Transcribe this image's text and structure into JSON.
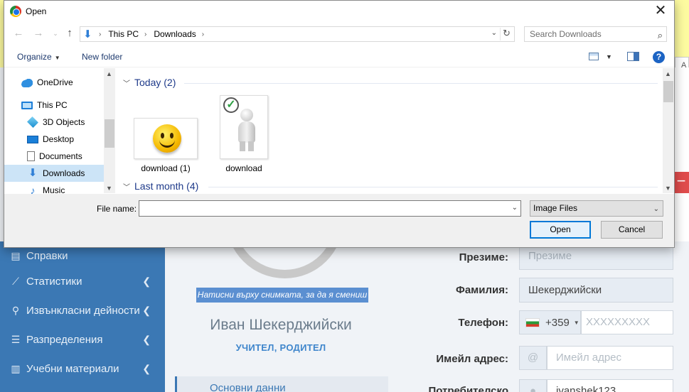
{
  "background": {
    "sidebar": {
      "items": [
        {
          "label": "Справки",
          "icon": "reference-icon",
          "has_arrow": false
        },
        {
          "label": "Статистики",
          "icon": "chart-icon",
          "has_arrow": true
        },
        {
          "label": "Извънкласни дейности",
          "icon": "running-icon",
          "has_arrow": true
        },
        {
          "label": "Разпределения",
          "icon": "list-icon",
          "has_arrow": true
        },
        {
          "label": "Учебни материали",
          "icon": "books-icon",
          "has_arrow": true
        }
      ]
    },
    "profile": {
      "photo_hint": "Натисни върху снимката, за да я смениш",
      "name": "Иван Шекерджийски",
      "role": "УЧИТЕЛ, РОДИТЕЛ",
      "tab_basic": "Основни данни"
    },
    "form": {
      "middle_name_label": "Презиме:",
      "middle_name_placeholder": "Презиме",
      "last_name_label": "Фамилия:",
      "last_name_value": "Шекерджийски",
      "phone_label": "Телефон:",
      "phone_prefix": "+359",
      "phone_placeholder": "XXXXXXXXX",
      "email_label": "Имейл адрес:",
      "email_placeholder": "Имейл адрес",
      "email_addon": "@",
      "username_label": "Потребителско",
      "username_value": "ivanshek123"
    },
    "topbar_partial": "A"
  },
  "dialog": {
    "title": "Open",
    "close_glyph": "✕",
    "address": {
      "segments": [
        "This PC",
        "Downloads"
      ],
      "search_placeholder": "Search Downloads"
    },
    "toolbar": {
      "organize_label": "Organize",
      "new_folder_label": "New folder",
      "help_label": "?"
    },
    "nav_items": [
      {
        "label": "OneDrive",
        "icon": "onedrive-icon"
      },
      {
        "label": "This PC",
        "icon": "this-pc-icon"
      },
      {
        "label": "3D Objects",
        "icon": "3d-objects-icon"
      },
      {
        "label": "Desktop",
        "icon": "desktop-icon"
      },
      {
        "label": "Documents",
        "icon": "documents-icon"
      },
      {
        "label": "Downloads",
        "icon": "downloads-icon",
        "selected": true
      },
      {
        "label": "Music",
        "icon": "music-icon"
      }
    ],
    "groups": [
      {
        "label": "Today (2)"
      },
      {
        "label": "Last month (4)"
      }
    ],
    "files": [
      {
        "name": "download (1)",
        "thumb": "smiley-image"
      },
      {
        "name": "download",
        "thumb": "checkmark-figure-image"
      }
    ],
    "file_name_label": "File name:",
    "file_name_value": "",
    "file_type": "Image Files",
    "open_label": "Open",
    "cancel_label": "Cancel"
  },
  "colors": {
    "sidebar_bg": "#3b78b4",
    "accent_blue": "#0078d7",
    "selection": "#cce4f7",
    "photo_hint_bg": "#5b8fd1"
  }
}
